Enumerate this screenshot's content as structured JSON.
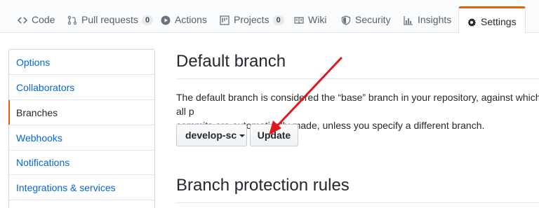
{
  "tabs": {
    "code": "Code",
    "pull_requests": "Pull requests",
    "pull_requests_count": "0",
    "actions": "Actions",
    "projects": "Projects",
    "projects_count": "0",
    "wiki": "Wiki",
    "security": "Security",
    "insights": "Insights",
    "settings": "Settings"
  },
  "sidebar": {
    "items": [
      {
        "label": "Options"
      },
      {
        "label": "Collaborators"
      },
      {
        "label": "Branches"
      },
      {
        "label": "Webhooks"
      },
      {
        "label": "Notifications"
      },
      {
        "label": "Integrations & services"
      }
    ],
    "selected": "Branches"
  },
  "main": {
    "default_branch_title": "Default branch",
    "description_line1": "The default branch is considered the “base” branch in your repository, against which all p",
    "description_line2": "commits are automatically made, unless you specify a different branch.",
    "branch_select_value": "develop-sc",
    "update_button": "Update",
    "protection_title": "Branch protection rules"
  },
  "colors": {
    "accent": "#e36209",
    "link": "#0366d6",
    "annotation_arrow": "#e0191b"
  }
}
